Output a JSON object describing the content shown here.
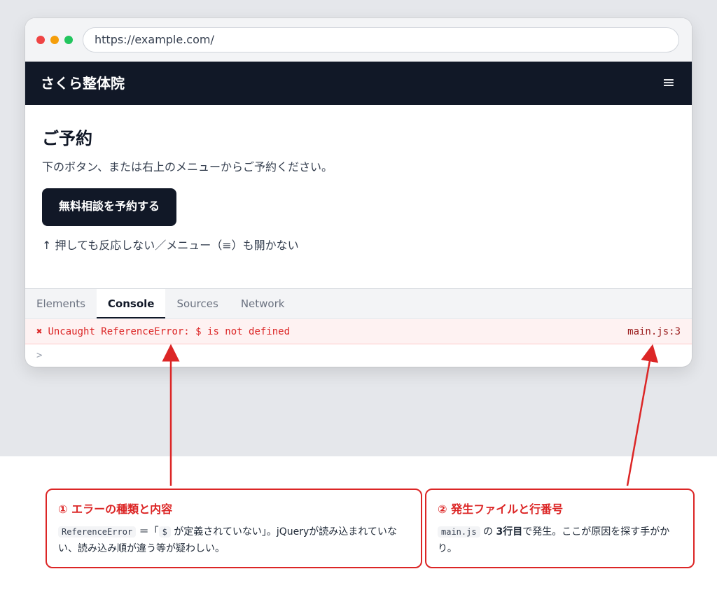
{
  "browser": {
    "url": "https://example.com/"
  },
  "site": {
    "brand": "さくら整体院",
    "menu_icon": "≡"
  },
  "page": {
    "title": "ご予約",
    "description": "下のボタン、または右上のメニューからご予約ください。",
    "cta_label": "無料相談を予約する",
    "note": "↑ 押しても反応しない／メニュー（≡）も開かない"
  },
  "devtools": {
    "tabs": [
      {
        "label": "Elements"
      },
      {
        "label": "Console"
      },
      {
        "label": "Sources"
      },
      {
        "label": "Network"
      }
    ],
    "active_tab": "Console",
    "error": {
      "icon": "✖",
      "message": "Uncaught ReferenceError: $ is not defined",
      "location": "main.js:3"
    },
    "prompt": ">"
  },
  "callouts": [
    {
      "title": "① エラーの種類と内容",
      "code1": "ReferenceError",
      "text1": " ＝「",
      "code2": "$",
      "text2": " が定義されていない」。jQueryが読み込まれていない、読み込み順が違う等が疑わしい。"
    },
    {
      "title": "② 発生ファイルと行番号",
      "code1": "main.js",
      "text1": " の ",
      "bold": "3行目",
      "text2": "で発生。ここが原因を探す手がかり。"
    }
  ],
  "colors": {
    "accent": "#dc2626",
    "navbar": "#111827",
    "error_bg": "#fef2f2"
  }
}
